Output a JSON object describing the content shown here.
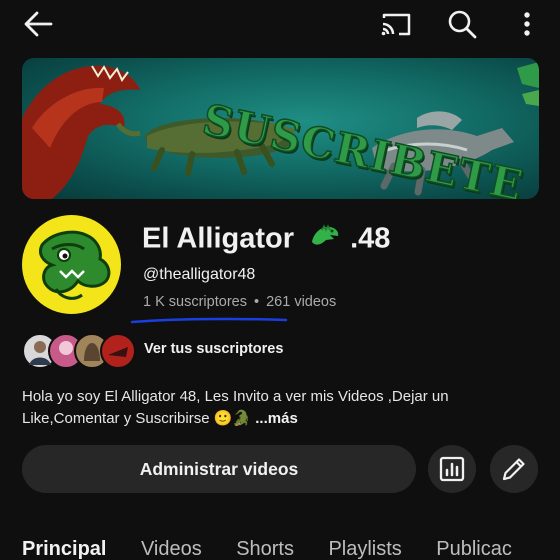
{
  "topbar": {
    "back_icon": "arrow-left-icon",
    "cast_icon": "cast-icon",
    "search_icon": "search-icon",
    "more_icon": "more-vertical-icon"
  },
  "banner": {
    "text": "SUSCRIBETE"
  },
  "channel": {
    "name": "El Alligator",
    "name_suffix": ".48",
    "handle": "@thealligator48",
    "subscribers": "1 K suscriptores",
    "separator": "•",
    "videos": "261 videos"
  },
  "subscribers_row": {
    "label": "Ver tus suscriptores",
    "avatar_colors": [
      "#d8d8d8",
      "#c85a8a",
      "#a0855a",
      "#b0221b"
    ]
  },
  "description": {
    "text": "Hola yo soy El Alligator 48, Les Invito a ver mis Videos ,Dejar un Like,Comentar y Suscribirse 🙂🐊",
    "more": "...más"
  },
  "actions": {
    "manage_videos": "Administrar videos",
    "analytics_icon": "analytics-icon",
    "edit_icon": "pencil-icon"
  },
  "tabs": [
    {
      "label": "Principal",
      "active": true
    },
    {
      "label": "Videos",
      "active": false
    },
    {
      "label": "Shorts",
      "active": false
    },
    {
      "label": "Playlists",
      "active": false
    },
    {
      "label": "Publicac",
      "active": false
    }
  ],
  "colors": {
    "background": "#0f0f0f",
    "button_bg": "#272727",
    "annotation_underline": "#1a3fe0",
    "avatar_bg": "#f3e51a"
  }
}
